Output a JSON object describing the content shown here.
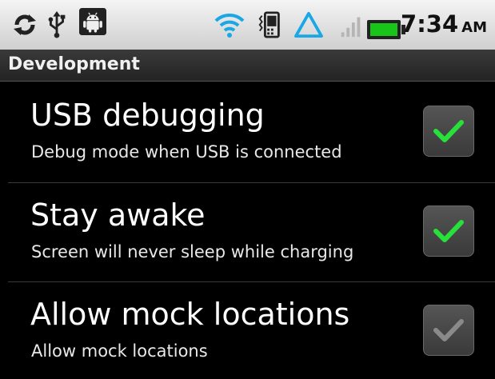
{
  "status_bar": {
    "time": "7:34",
    "am_pm": "AM",
    "icons": [
      "sync-icon",
      "usb-icon",
      "android-debug-icon",
      "wifi-icon",
      "vibrate-icon",
      "data-triangle-icon",
      "signal-icon",
      "battery-icon"
    ]
  },
  "section": {
    "title": "Development"
  },
  "preferences": [
    {
      "label": "USB debugging",
      "summary": "Debug mode when USB is connected",
      "checked": true,
      "enabled": true
    },
    {
      "label": "Stay awake",
      "summary": "Screen will never sleep while charging",
      "checked": true,
      "enabled": true
    },
    {
      "label": "Allow mock locations",
      "summary": "Allow mock locations",
      "checked": true,
      "enabled": false
    }
  ],
  "colors": {
    "check_active": "#27e03a",
    "check_inactive": "#8a8a8a",
    "battery_fill": "#19c519",
    "wifi": "#1aa7e6",
    "triangle": "#1aa7e6"
  }
}
